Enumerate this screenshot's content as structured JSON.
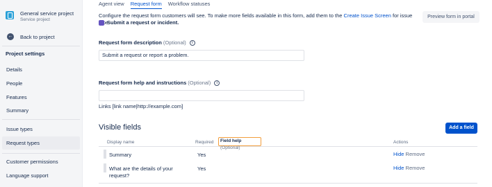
{
  "project": {
    "name": "General service project",
    "type": "Service project"
  },
  "sidebar": {
    "back_label": "Back to project",
    "heading": "Project settings",
    "items": [
      {
        "label": "Details"
      },
      {
        "label": "People"
      },
      {
        "label": "Features"
      },
      {
        "label": "Summary"
      },
      {
        "label": "Issue types"
      },
      {
        "label": "Request types"
      },
      {
        "label": "Customer permissions"
      },
      {
        "label": "Language support"
      }
    ]
  },
  "tabs": [
    {
      "label": "Agent view"
    },
    {
      "label": "Request form"
    },
    {
      "label": "Workflow statuses"
    }
  ],
  "intro": {
    "text_before": "Configure the request form customers will see. To make more fields available in this form, add them to the ",
    "link": "Create Issue Screen",
    "text_after": " for issue type",
    "issue_type": "Submit a request or incident."
  },
  "preview_button": "Preview form in portal",
  "description": {
    "label": "Request form description",
    "optional": "(Optional)",
    "value": "Submit a request or report a problem."
  },
  "help": {
    "label": "Request form help and instructions",
    "optional": "(Optional)",
    "value": "",
    "links_hint": "Links [link name|http://example.com]"
  },
  "visible_fields": {
    "title": "Visible fields",
    "add_button": "Add a field",
    "columns": {
      "display_name": "Display name",
      "required": "Required",
      "field_help": "Field help",
      "field_help_optional": "(Optional)",
      "actions": "Actions"
    },
    "rows": [
      {
        "name": "Summary",
        "required": "Yes",
        "hide": "Hide",
        "remove": "Remove"
      },
      {
        "name_line1": "What are the details of your",
        "name_line2": "request?",
        "required": "Yes",
        "hide": "Hide",
        "remove": "Remove"
      }
    ]
  },
  "colors": {
    "accent": "#0052cc",
    "highlight": "#f29d3b",
    "issue_icon": "#6554c0",
    "project_icon": "#2aa0d8"
  }
}
